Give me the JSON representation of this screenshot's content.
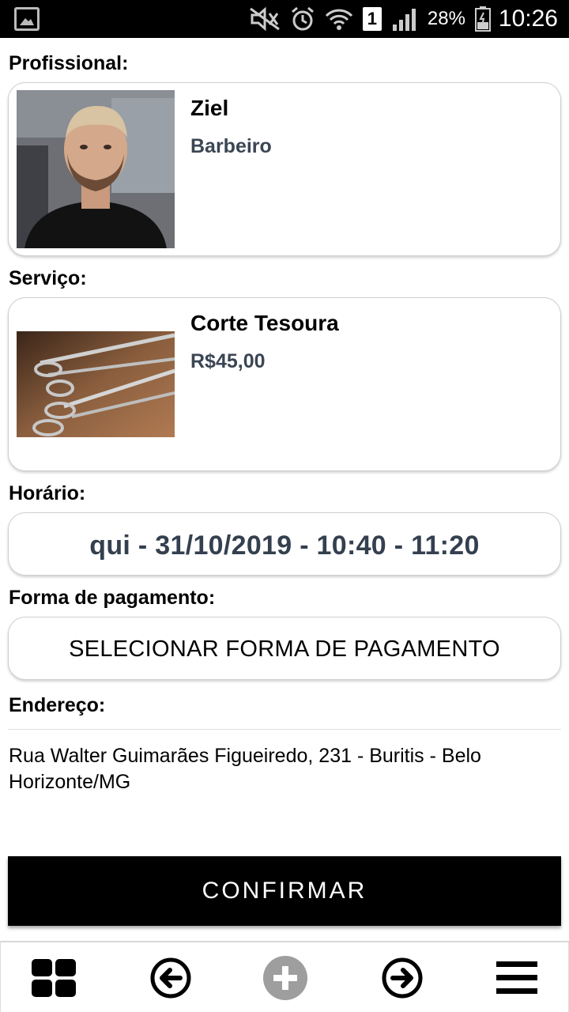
{
  "status_bar": {
    "battery": "28%",
    "sim_slot": "1",
    "time": "10:26"
  },
  "professional": {
    "label": "Profissional:",
    "name": "Ziel",
    "role": "Barbeiro"
  },
  "service": {
    "label": "Serviço:",
    "name": "Corte Tesoura",
    "price": "R$45,00"
  },
  "schedule": {
    "label": "Horário:",
    "value": "qui - 31/10/2019 - 10:40 - 11:20"
  },
  "payment": {
    "label": "Forma de pagamento:",
    "button": "SELECIONAR FORMA DE PAGAMENTO"
  },
  "address": {
    "label": "Endereço:",
    "value": "Rua Walter Guimarães Figueiredo, 231 - Buritis - Belo Horizonte/MG"
  },
  "confirm_button": "CONFIRMAR",
  "bottom_nav": {
    "icons": [
      "grid-icon",
      "arrow-left-circle-icon",
      "plus-circle-icon",
      "arrow-right-circle-icon",
      "menu-icon"
    ]
  },
  "colors": {
    "subtitle": "#3b4654",
    "schedule_text": "#34404f",
    "confirm_bg": "#000000",
    "plus_icon_disabled": "#9e9e9e"
  }
}
